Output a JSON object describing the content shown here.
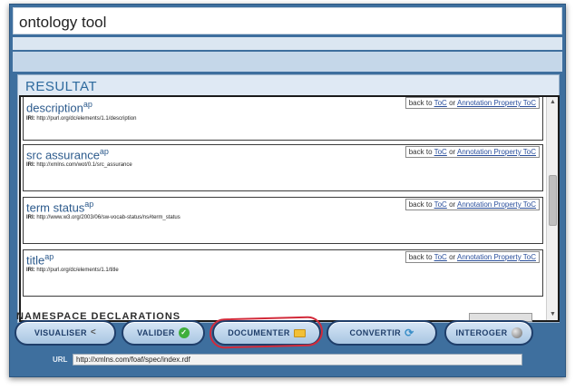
{
  "app": {
    "title": "ontology tool"
  },
  "results": {
    "heading": "RESULTAT",
    "entries": [
      {
        "name": "description",
        "tag": "ap",
        "iri_label": "IRI:",
        "iri": "http://purl.org/dc/elements/1.1/description",
        "back_to": "back to",
        "toc": "ToC",
        "or": "or",
        "prop_toc": "Annotation Property ToC"
      },
      {
        "name": "src assurance",
        "tag": "ap",
        "iri_label": "IRI:",
        "iri": "http://xmlns.com/wot/0.1/src_assurance",
        "back_to": "back to",
        "toc": "ToC",
        "or": "or",
        "prop_toc": "Annotation Property ToC"
      },
      {
        "name": "term status",
        "tag": "ap",
        "iri_label": "IRI:",
        "iri": "http://www.w3.org/2003/06/sw-vocab-status/ns#term_status",
        "back_to": "back to",
        "toc": "ToC",
        "or": "or",
        "prop_toc": "Annotation Property ToC"
      },
      {
        "name": "title",
        "tag": "ap",
        "iri_label": "IRI:",
        "iri": "http://purl.org/dc/elements/1.1/title",
        "back_to": "back to",
        "toc": "ToC",
        "or": "or",
        "prop_toc": "Annotation Property ToC"
      }
    ],
    "cutoff_heading": "NAMESPACE DECLARATIONS"
  },
  "toolbar": {
    "visualiser": "VISUALISER",
    "valider": "VALIDER",
    "documenter": "DOCUMENTER",
    "convertir": "CONVERTIR",
    "interoger": "INTEROGER"
  },
  "icons": {
    "visualiser": "share-icon",
    "valider": "check-icon",
    "documenter": "folder-icon",
    "convertir": "refresh-icon",
    "interoger": "globe-icon"
  },
  "url": {
    "label": "URL",
    "value": "http://xmlns.com/foaf/spec/index.rdf"
  },
  "colors": {
    "frame": "#3e6f9e",
    "accent": "#2e6a9e",
    "highlight": "#d22a3a"
  }
}
